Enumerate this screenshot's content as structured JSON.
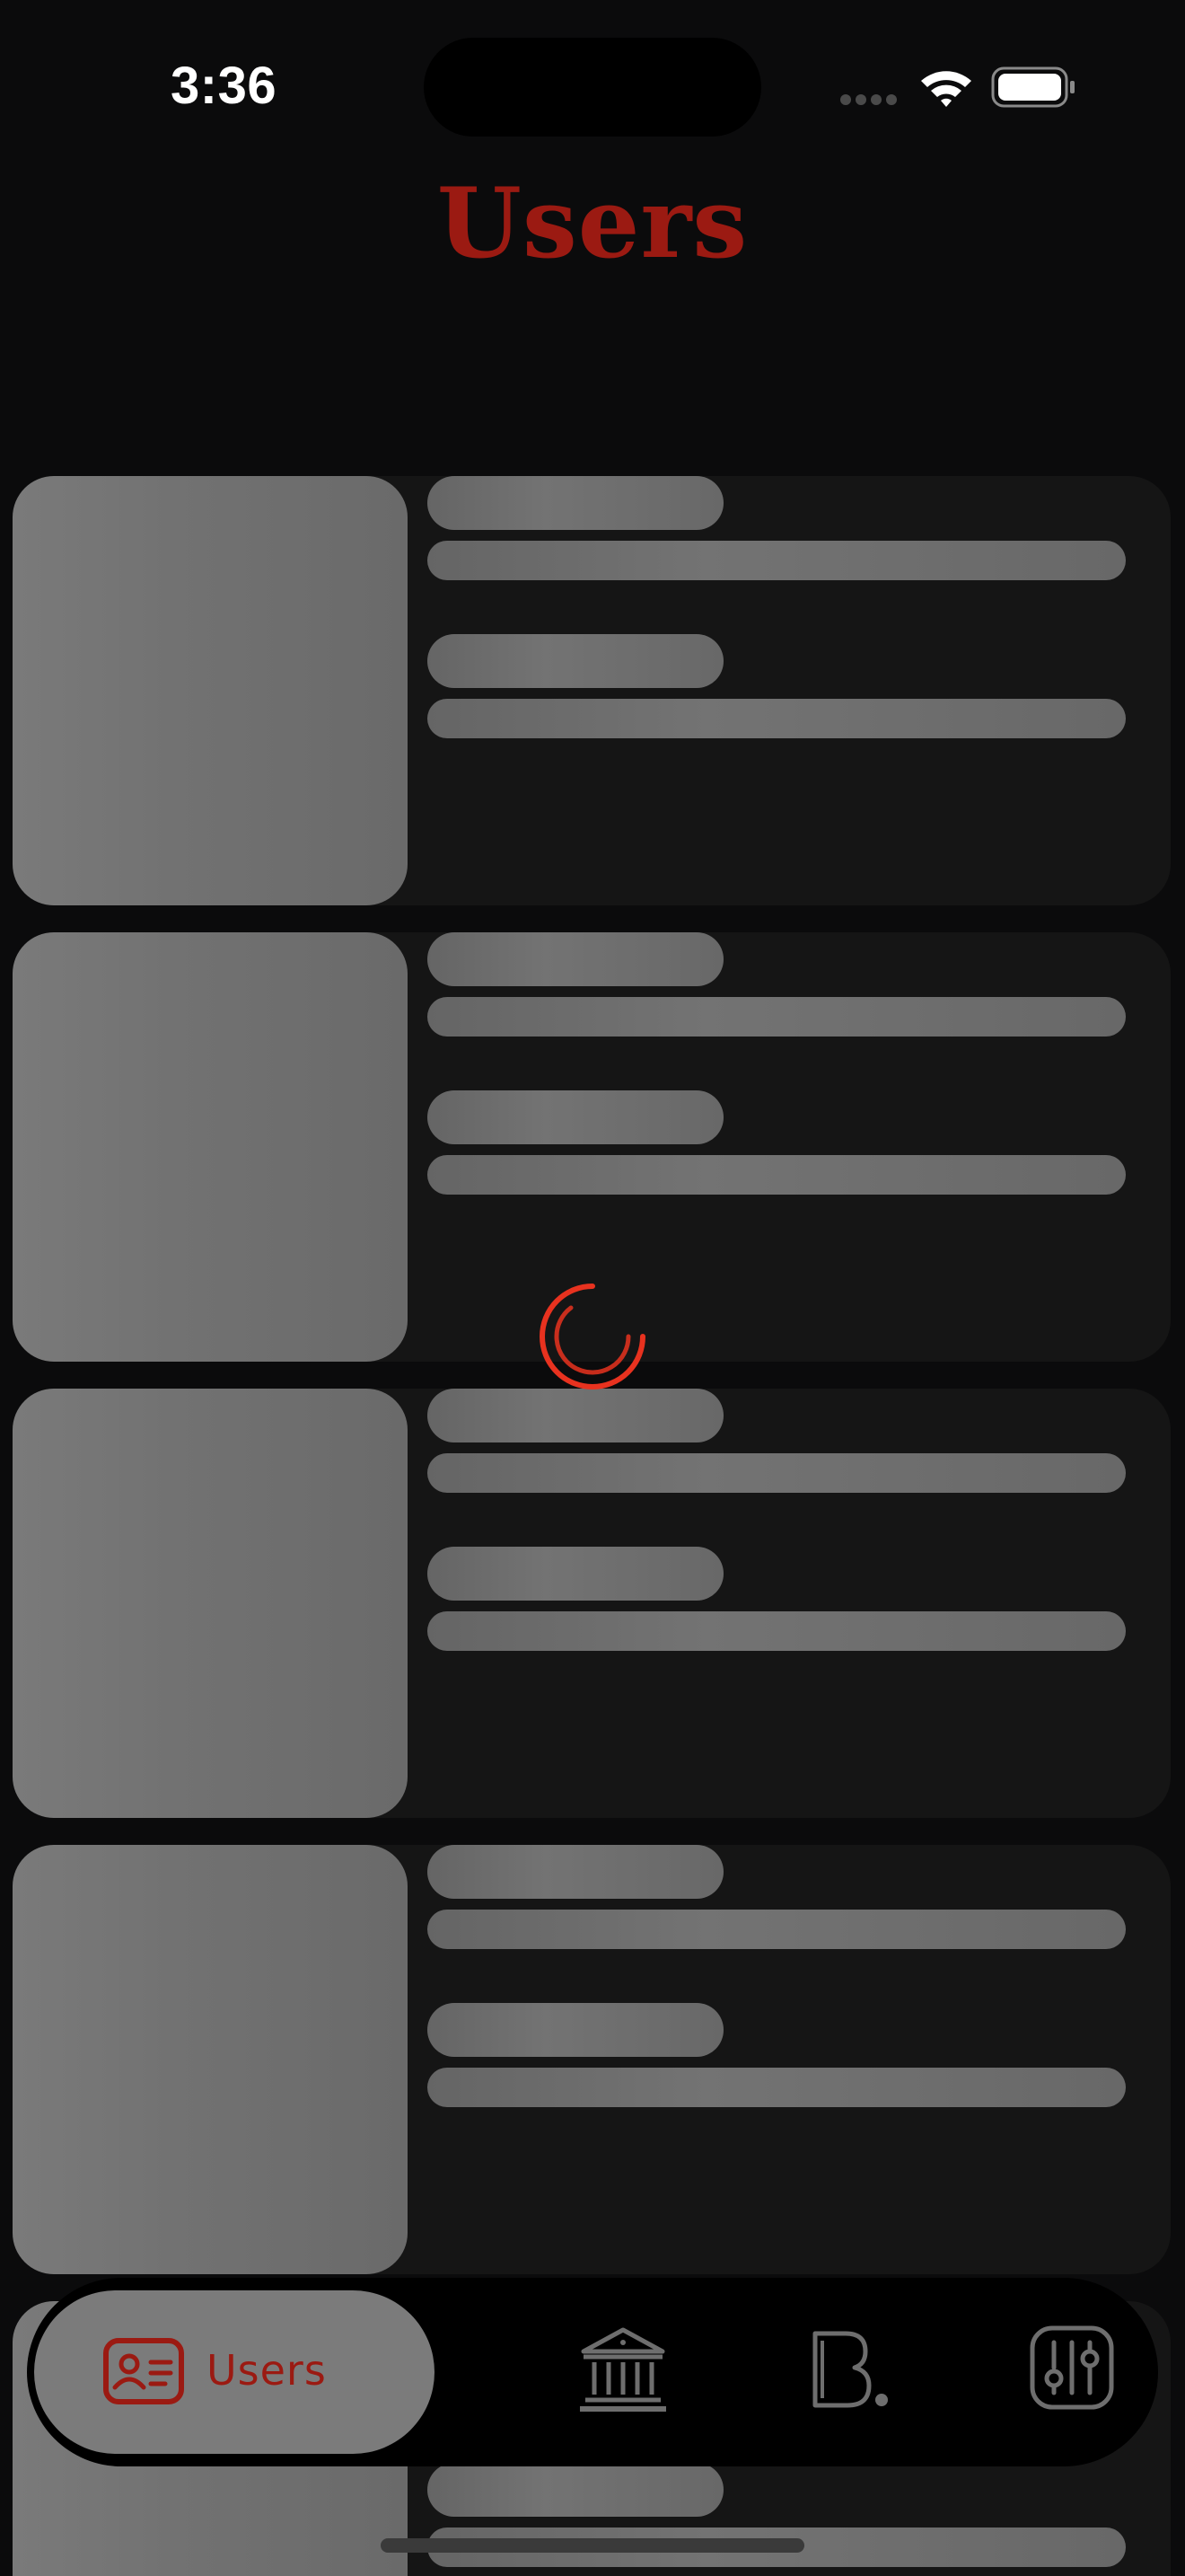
{
  "status_bar": {
    "time": "3:36"
  },
  "header": {
    "title": "Users"
  },
  "cards_count_note": "",
  "tab_bar": {
    "tabs": [
      {
        "label": "Users",
        "icon": "user-card-icon",
        "active": true
      },
      {
        "label": "",
        "icon": "bank-icon",
        "active": false
      },
      {
        "label": "",
        "icon": "b-logo-icon",
        "active": false
      },
      {
        "label": "",
        "icon": "sliders-icon",
        "active": false
      }
    ]
  },
  "colors": {
    "accent": "#9b1a12",
    "spinner": "#e8321f",
    "background": "#0b0b0c"
  }
}
